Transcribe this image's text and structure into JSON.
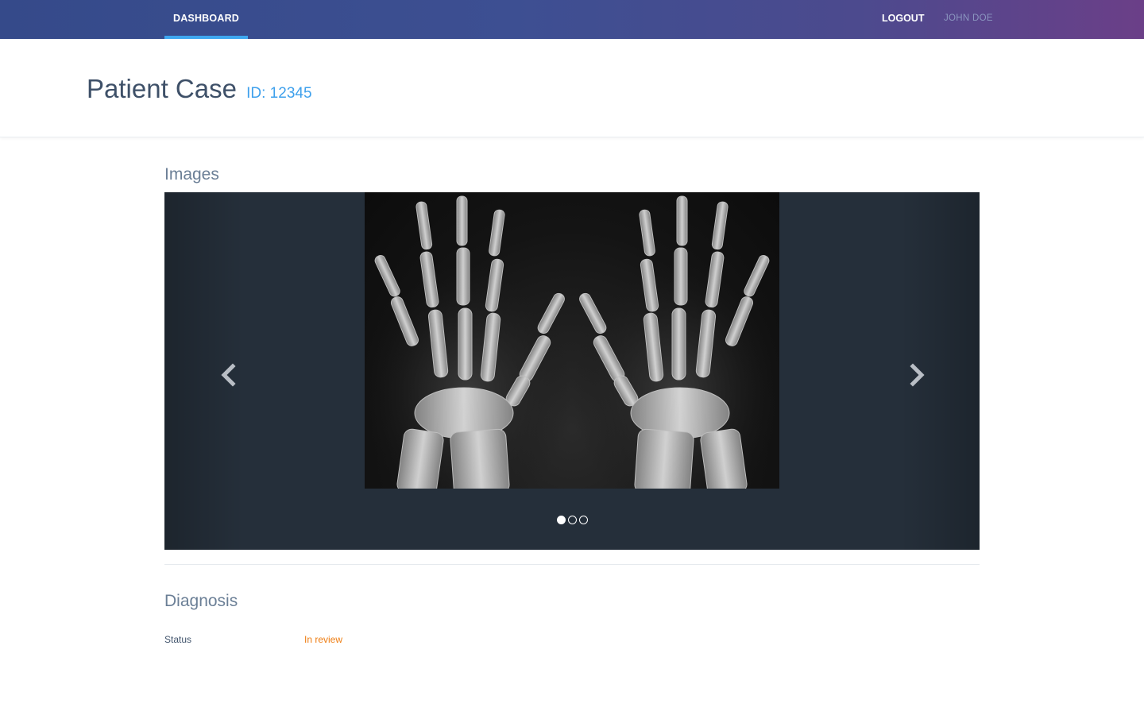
{
  "nav": {
    "active_tab": "DASHBOARD",
    "logout_label": "LOGOUT",
    "user_name": "JOHN DOE"
  },
  "header": {
    "title": "Patient Case",
    "id_label": "ID: 12345"
  },
  "images": {
    "section_title": "Images",
    "prev_icon": "chevron-left-icon",
    "next_icon": "chevron-right-icon",
    "slide_count": 3,
    "active_slide": 1
  },
  "diagnosis": {
    "section_title": "Diagnosis",
    "status_label": "Status",
    "status_value": "In review"
  },
  "colors": {
    "nav_gradient_start": "#354a8a",
    "nav_gradient_end": "#6b3f88",
    "accent_blue": "#3ea7f0",
    "status_orange": "#ee7d12",
    "carousel_bg": "#252f3a"
  }
}
